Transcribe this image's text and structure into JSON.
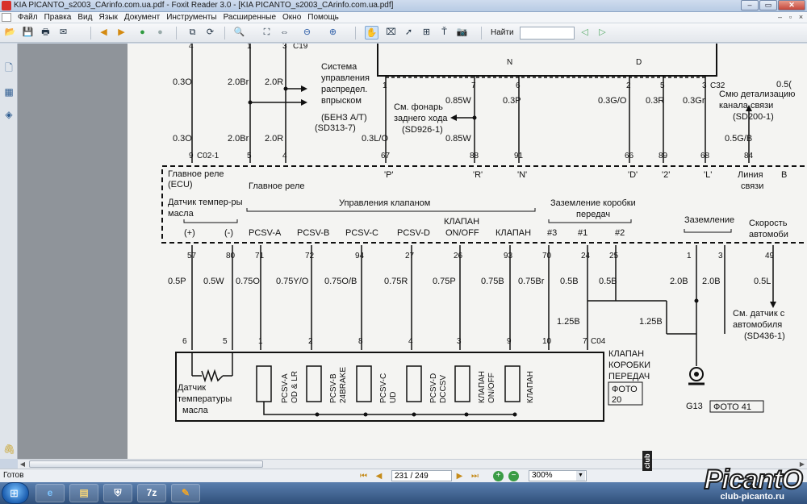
{
  "window": {
    "title": "KIA PICANTO_s2003_CArinfo.com.ua.pdf - Foxit Reader 3.0 - [KIA PICANTO_s2003_CArinfo.com.ua.pdf]",
    "minimize": "–",
    "restore": "▭",
    "close": "✕"
  },
  "menu": [
    "Файл",
    "Правка",
    "Вид",
    "Язык",
    "Документ",
    "Инструменты",
    "Расширенные",
    "Окно",
    "Помощь"
  ],
  "toolbar": {
    "find_label": "Найти",
    "find_value": ""
  },
  "status": {
    "text": "Готов",
    "page_value": "231 / 249",
    "zoom_value": "300%"
  },
  "watermark": {
    "brand": "PicantO",
    "club": "club",
    "url": "club-picanto.ru"
  },
  "diagram": {
    "top_pins": [
      "4",
      "1",
      "3",
      "C19"
    ],
    "top_wires": [
      "0.3O",
      "2.0Br",
      "2.0R",
      "2.0Br",
      "2.0R"
    ],
    "fuel_note": [
      "Система",
      "управления",
      "распредел.",
      "впрыском",
      "(БЕНЗ А/Т)",
      "(SD313-7)"
    ],
    "ecu_top_wires": [
      "0.3O",
      "0.3L/O",
      "0.85W",
      "0.85W",
      "0.3P",
      "0.3G/O",
      "0.3R",
      "0.3Gr",
      "0.5G/B",
      "0.5("
    ],
    "ecu_top_pins": [
      "9",
      "C02-1",
      "5",
      "4",
      "67",
      "88",
      "91",
      "66",
      "89",
      "68",
      "84"
    ],
    "module_top_pins": [
      "1",
      "7",
      "6",
      "2",
      "5",
      "3",
      "C32"
    ],
    "module_letters": [
      "N",
      "D"
    ],
    "lamp_note": [
      "См. фонарь",
      "заднего хода",
      "(SD926-1)"
    ],
    "diag_note": [
      "Смю детализацию",
      "канала связи",
      "(SD200-1)"
    ],
    "ecu_labels": {
      "main_relay": "Главное реле",
      "ecu": "(ECU)",
      "main_relay2": "Главное реле",
      "p": "'P'",
      "r": "'R'",
      "n": "'N'",
      "d": "'D'",
      "two": "'2'",
      "l": "'L'",
      "comm_line": "Линия",
      "comm_line2": "связи",
      "v": "В",
      "vehicle": "автомоби",
      "temp_sensor": "Датчик темпер-ры",
      "oil": "масла",
      "valve_ctrl": "Управления клапаном",
      "gearbox_ground": "Заземление коробки",
      "transmission": "передач",
      "ground": "Заземление",
      "speed": "Скорость"
    },
    "ecu_pin_names": [
      "(+)",
      "(-)",
      "PCSV-A",
      "PCSV-B",
      "PCSV-C",
      "PCSV-D",
      "КЛАПАН",
      "ON/OFF",
      "КЛАПАН",
      "#3",
      "#1",
      "#2"
    ],
    "ecu_bottom_pins": [
      "57",
      "80",
      "71",
      "72",
      "94",
      "27",
      "26",
      "93",
      "70",
      "24",
      "25",
      "1",
      "3",
      "49"
    ],
    "bottom_wires": [
      "0.5P",
      "0.5W",
      "0.75O",
      "0.75Y/O",
      "0.75O/B",
      "0.75R",
      "0.75P",
      "0.75B",
      "0.75Br",
      "0.5B",
      "0.5B",
      "2.0B",
      "2.0B",
      "0.5L"
    ],
    "mid_wires": [
      "1.25B",
      "1.25B"
    ],
    "valve_pins": [
      "6",
      "5",
      "1",
      "2",
      "8",
      "4",
      "3",
      "9",
      "10",
      "7",
      "C04"
    ],
    "valve_labels": [
      "PCSV-A",
      "OD & LR",
      "PCSV-B",
      "24BRAKE",
      "PCSV-C",
      "UD",
      "PCSV-D",
      "DCCSV",
      "КЛАПАН",
      "ON/OFF",
      "КЛАПАН"
    ],
    "sensor_label": [
      "Датчик",
      "температуры",
      "масла"
    ],
    "gearbox_label": [
      "КЛАПАН",
      "КОРОБКИ",
      "ПЕРЕДАЧ"
    ],
    "photo20": [
      "ФОТО",
      "20"
    ],
    "g13": "G13",
    "photo41": "ФОТО 41",
    "speed_note": [
      "См. датчик с",
      "автомобиля",
      "(SD436-1)"
    ]
  }
}
